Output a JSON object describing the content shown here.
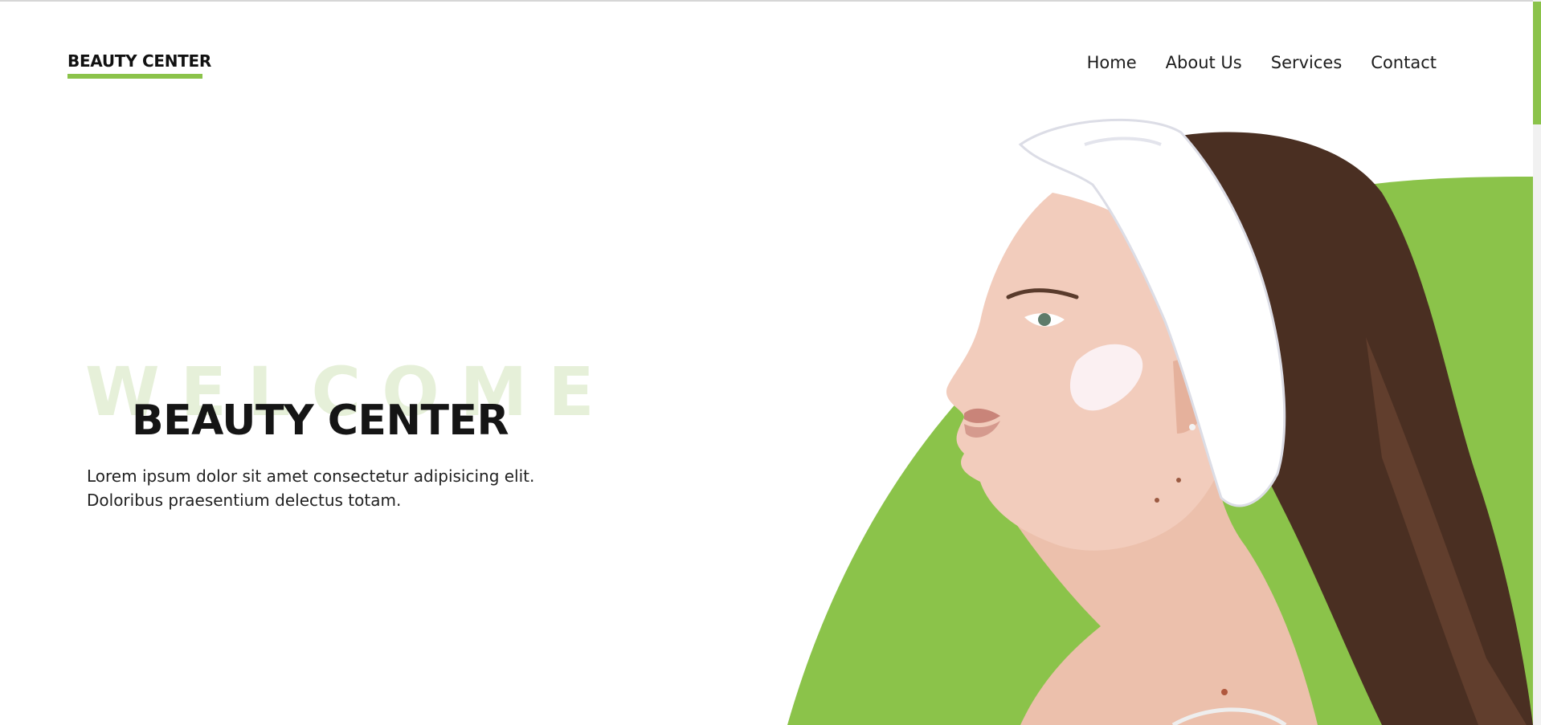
{
  "header": {
    "logo": "BEAUTY CENTER",
    "nav": [
      "Home",
      "About Us",
      "Services",
      "Contact"
    ]
  },
  "hero": {
    "watermark": "WELCOME",
    "title": "BEAUTY CENTER",
    "text_line1": "Lorem ipsum dolor sit amet consectetur adipisicing elit.",
    "text_line2": "Doloribus praesentium delectus totam."
  },
  "colors": {
    "accent": "#8bc34a",
    "watermark": "#e6f0d9",
    "text": "#1c1c1c"
  },
  "icons": {
    "hero_image": "woman-with-headband-and-face-cream"
  }
}
